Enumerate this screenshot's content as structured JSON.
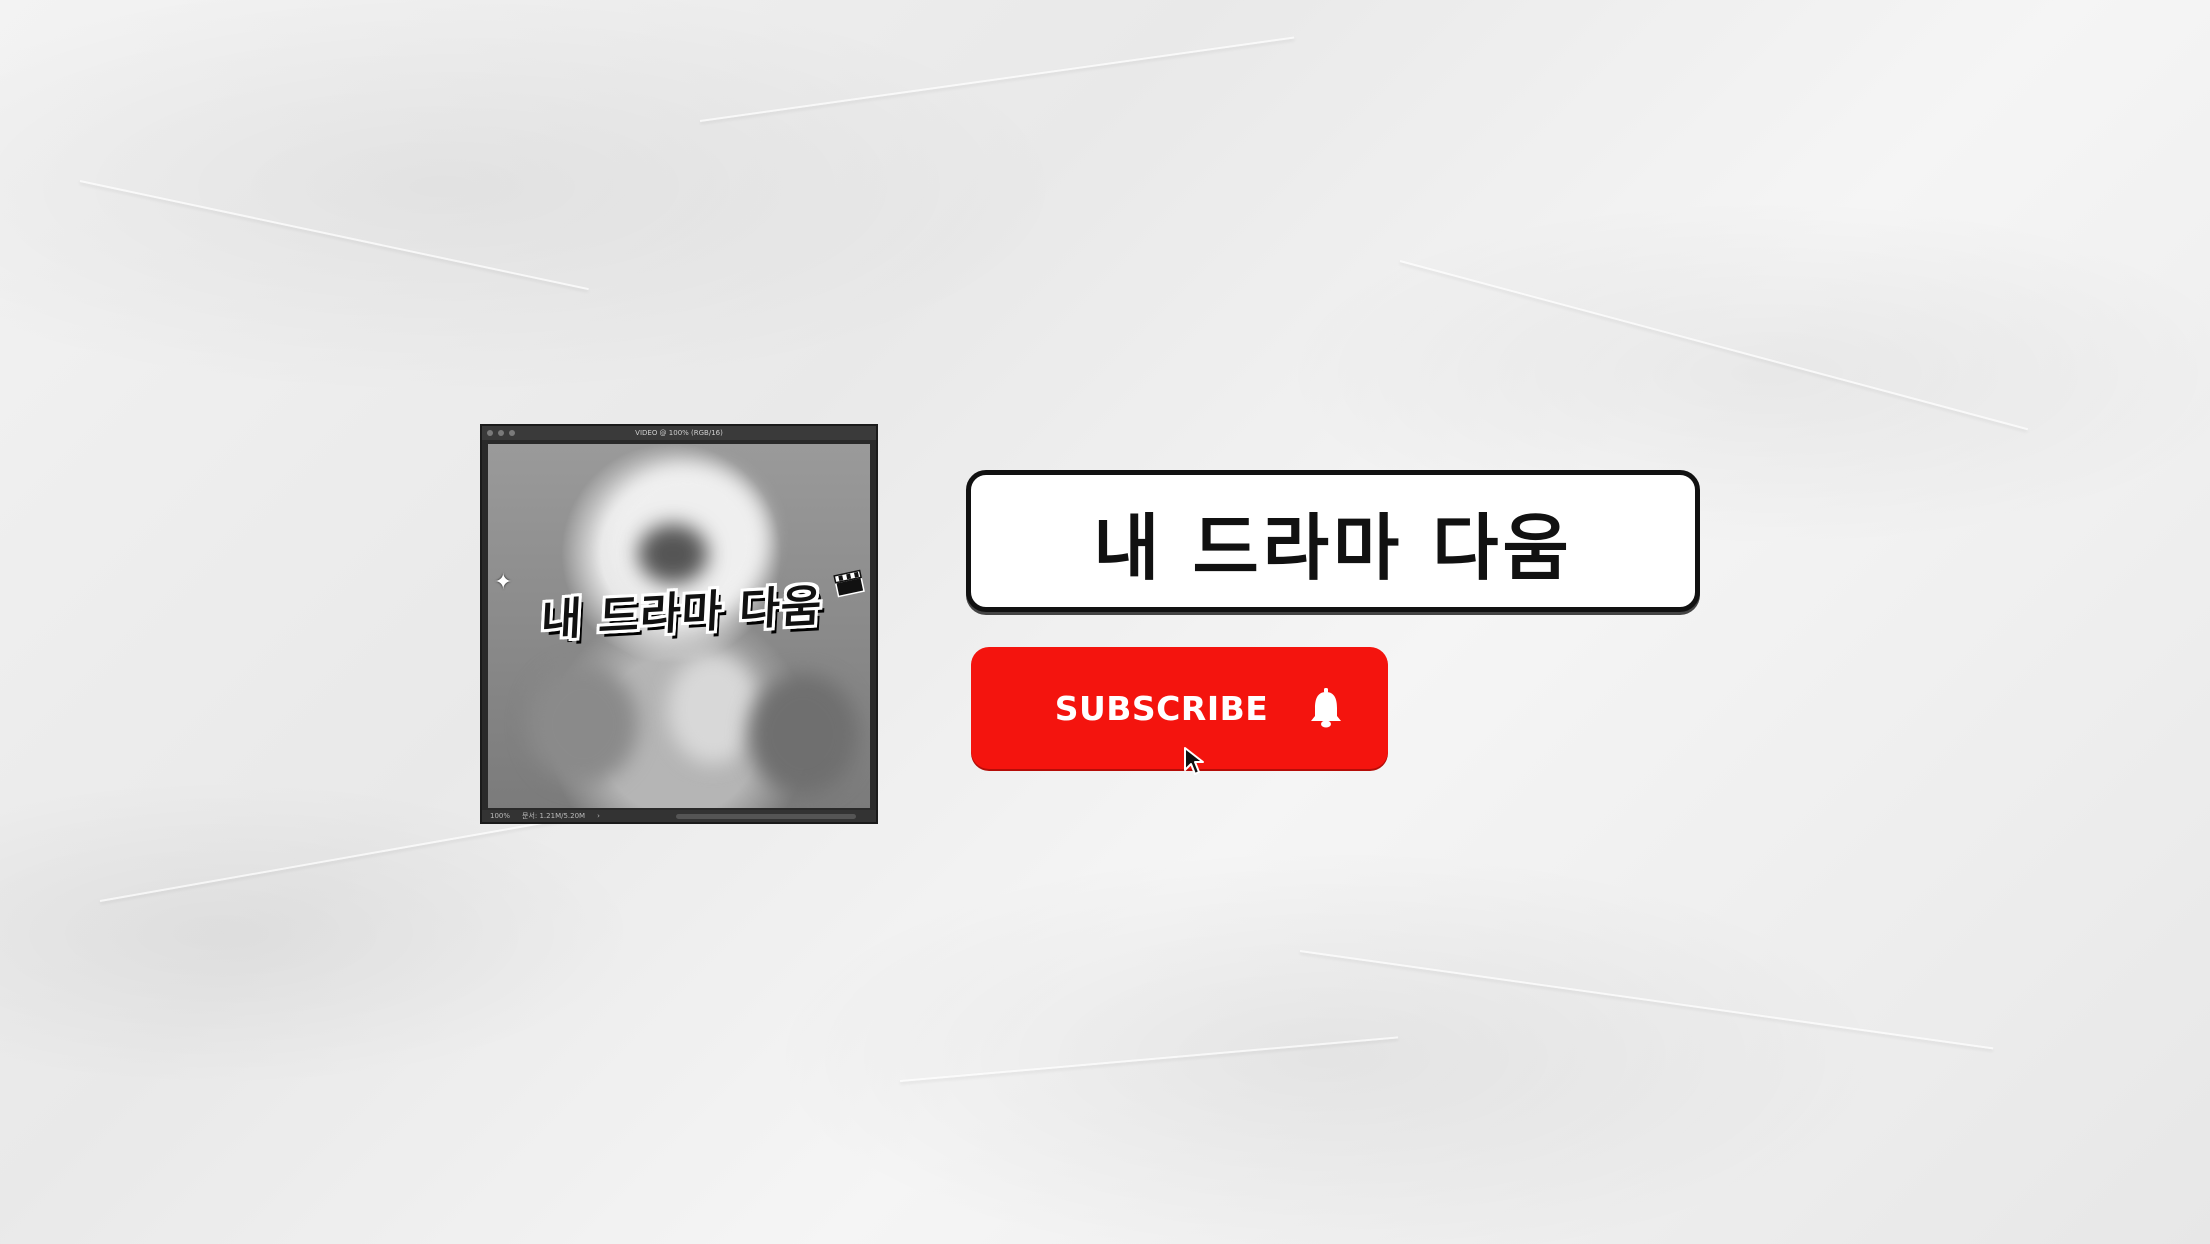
{
  "thumbnail": {
    "title": "VIDEO @ 100% (RGB/16)",
    "logo_text": "내 드라마 다움",
    "status_zoom": "100%",
    "status_doc": "문서: 1.21M/5.20M",
    "status_arrow": "›"
  },
  "channel": {
    "name": "내 드라마 다움"
  },
  "subscribe": {
    "label": "SUBSCRIBE",
    "color": "#f4140e"
  },
  "icons": {
    "bell": "bell-icon",
    "cursor": "cursor-icon",
    "sparkle": "sparkle-icon",
    "clapper": "clapperboard-icon"
  }
}
